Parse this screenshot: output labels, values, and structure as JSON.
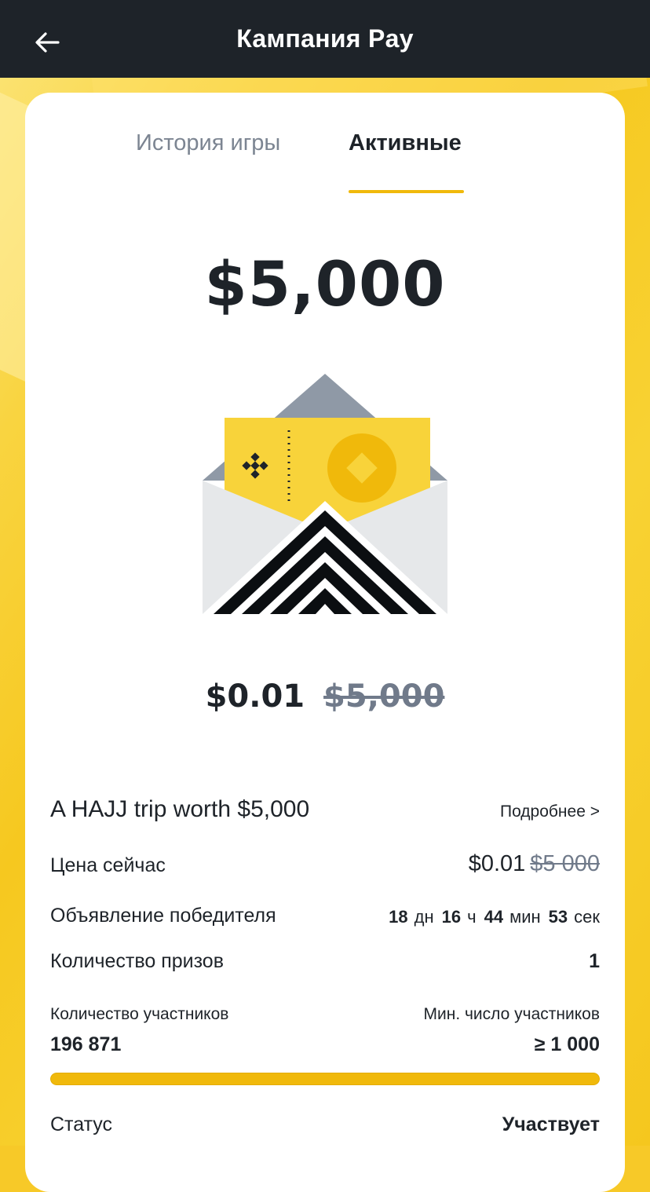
{
  "header": {
    "title": "Кампания Pay"
  },
  "tabs": [
    {
      "label": "История игры",
      "active": false
    },
    {
      "label": "Активные",
      "active": true
    }
  ],
  "prize_amount": "$5,000",
  "price_display": {
    "current": "$0.01",
    "original": "$5,000"
  },
  "campaign": {
    "title": "A HAJJ trip worth $5,000",
    "details_link": "Подробнее >"
  },
  "current_price": {
    "label": "Цена сейчас",
    "value": "$0.01",
    "original": "$5 000"
  },
  "winner_announcement": {
    "label": "Объявление победителя",
    "days": "18",
    "days_unit": "дн",
    "hours": "16",
    "hours_unit": "ч",
    "minutes": "44",
    "minutes_unit": "мин",
    "seconds": "53",
    "seconds_unit": "сек"
  },
  "prizes": {
    "label": "Количество призов",
    "value": "1"
  },
  "participants": {
    "label": "Количество участников",
    "value": "196 871",
    "min_label": "Мин. число участников",
    "min_value": "≥ 1 000",
    "progress_percent": 100
  },
  "status": {
    "label": "Статус",
    "value": "Участвует"
  },
  "colors": {
    "accent": "#F0B90B",
    "topbar": "#1E2329",
    "text": "#1E2329",
    "muted": "#707A8A"
  },
  "icons": {
    "back": "arrow-left-icon",
    "illustration": "envelope-ticket-icon",
    "logo": "binance-logo-icon"
  }
}
